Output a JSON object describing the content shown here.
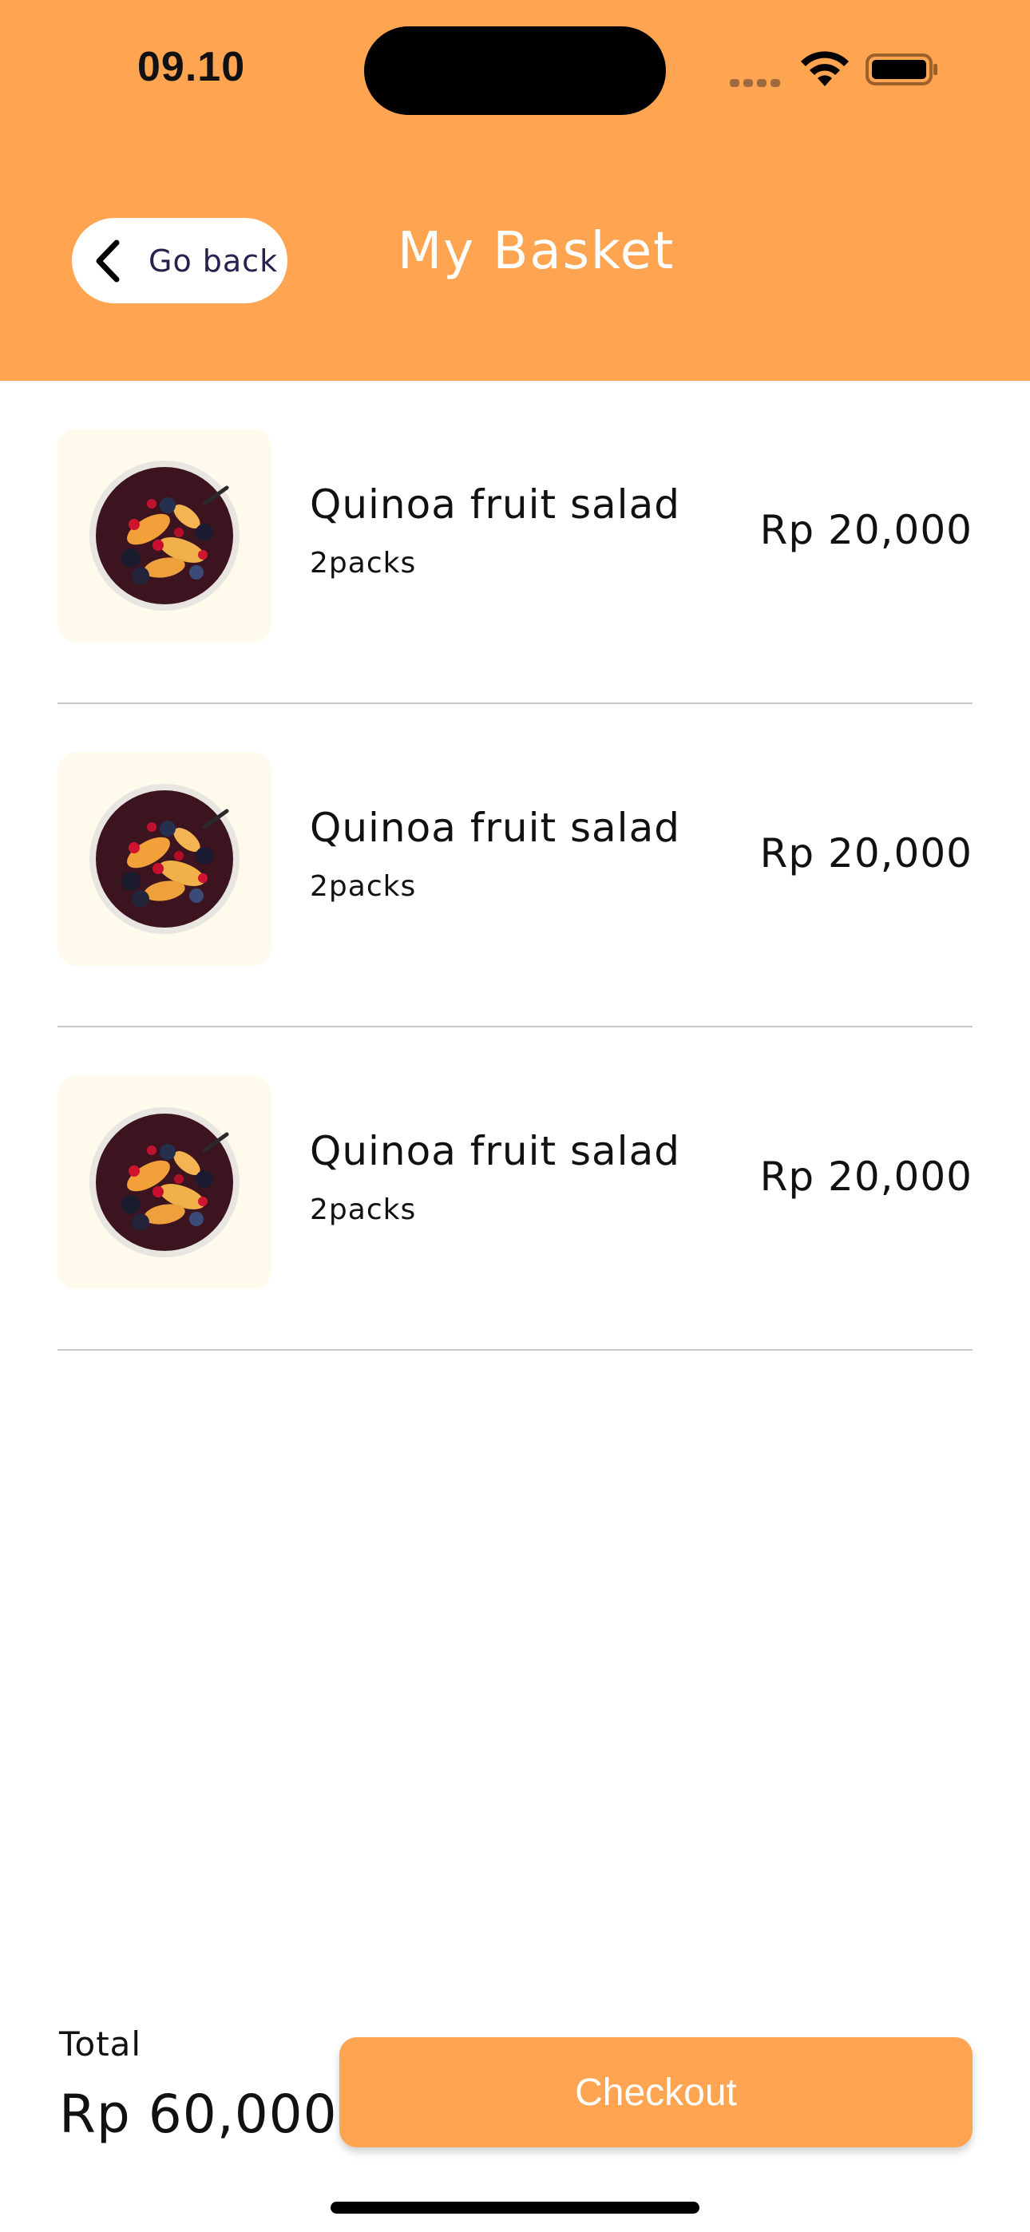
{
  "status_bar": {
    "time": "09.10"
  },
  "header": {
    "back_label": "Go back",
    "title": "My Basket"
  },
  "colors": {
    "accent": "#FFA451",
    "thumb_bg": "#FFFAEB",
    "text": "#111111"
  },
  "items": [
    {
      "name": "Quinoa fruit salad",
      "quantity": "2packs",
      "price": "Rp 20,000",
      "image": "fruit-salad-bowl"
    },
    {
      "name": "Quinoa fruit salad",
      "quantity": "2packs",
      "price": "Rp 20,000",
      "image": "fruit-salad-bowl"
    },
    {
      "name": "Quinoa fruit salad",
      "quantity": "2packs",
      "price": "Rp 20,000",
      "image": "fruit-salad-bowl"
    }
  ],
  "footer": {
    "total_label": "Total",
    "total_value": "Rp 60,000",
    "checkout_label": "Checkout"
  }
}
